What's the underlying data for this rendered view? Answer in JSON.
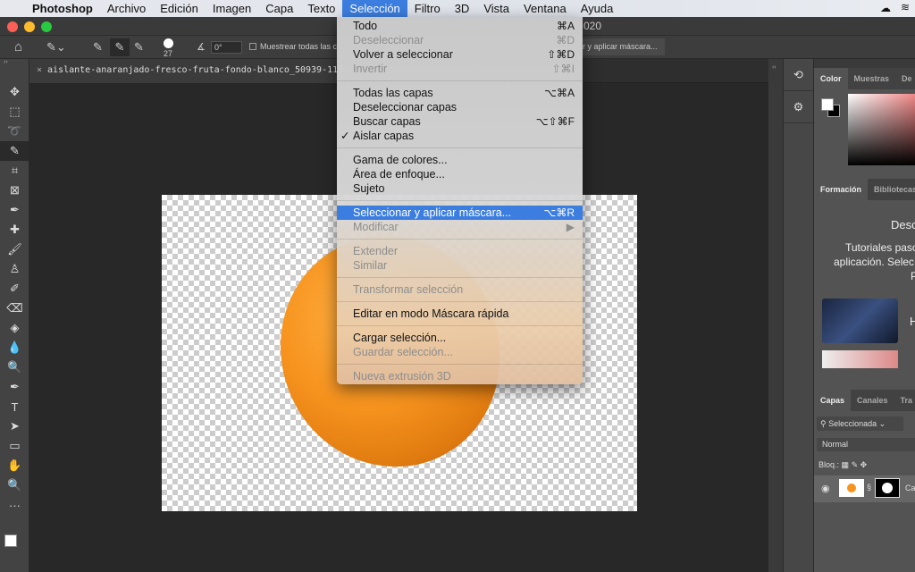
{
  "menubar": {
    "apple": "",
    "app": "Photoshop",
    "items": [
      "Archivo",
      "Edición",
      "Imagen",
      "Capa",
      "Texto",
      "Selección",
      "Filtro",
      "3D",
      "Vista",
      "Ventana",
      "Ayuda"
    ]
  },
  "titlebar": {
    "title_fragment": "020"
  },
  "options": {
    "brush_size": "27",
    "angle": "0°",
    "sample_all_label": "Muestrear todas las c",
    "select_mask_button": "r y aplicar máscara..."
  },
  "document": {
    "tab": "aislante-anaranjado-fresco-fruta-fondo-blanco_50939-115.jpg a"
  },
  "menu": {
    "items": [
      {
        "label": "Todo",
        "key": "⌘A",
        "disabled": false
      },
      {
        "label": "Deseleccionar",
        "key": "⌘D",
        "disabled": true
      },
      {
        "label": "Volver a seleccionar",
        "key": "⇧⌘D",
        "disabled": false
      },
      {
        "label": "Invertir",
        "key": "⇧⌘I",
        "disabled": true
      },
      {
        "sep": true
      },
      {
        "label": "Todas las capas",
        "key": "⌥⌘A",
        "disabled": false
      },
      {
        "label": "Deseleccionar capas",
        "key": "",
        "disabled": false
      },
      {
        "label": "Buscar capas",
        "key": "⌥⇧⌘F",
        "disabled": false
      },
      {
        "label": "Aislar capas",
        "key": "",
        "disabled": false,
        "checked": true
      },
      {
        "sep": true
      },
      {
        "label": "Gama de colores...",
        "key": "",
        "disabled": false
      },
      {
        "label": "Área de enfoque...",
        "key": "",
        "disabled": false
      },
      {
        "label": "Sujeto",
        "key": "",
        "disabled": false
      },
      {
        "sep": true
      },
      {
        "label": "Seleccionar y aplicar máscara...",
        "key": "⌥⌘R",
        "disabled": false,
        "highlighted": true
      },
      {
        "label": "Modificar",
        "key": "▶",
        "disabled": true
      },
      {
        "sep": true
      },
      {
        "label": "Extender",
        "key": "",
        "disabled": true
      },
      {
        "label": "Similar",
        "key": "",
        "disabled": true
      },
      {
        "sep": true
      },
      {
        "label": "Transformar selección",
        "key": "",
        "disabled": true
      },
      {
        "sep": true
      },
      {
        "label": "Editar en modo Máscara rápida",
        "key": "",
        "disabled": false
      },
      {
        "sep": true
      },
      {
        "label": "Cargar selección...",
        "key": "",
        "disabled": false
      },
      {
        "label": "Guardar selección...",
        "key": "",
        "disabled": true
      },
      {
        "sep": true
      },
      {
        "label": "Nueva extrusión 3D",
        "key": "",
        "disabled": true
      }
    ]
  },
  "tools": [
    "move-icon",
    "marquee-icon",
    "lasso-icon",
    "quick-selection-icon",
    "crop-icon",
    "frame-icon",
    "eyedropper-icon",
    "healing-icon",
    "brush-icon",
    "stamp-icon",
    "history-brush-icon",
    "eraser-icon",
    "paint-bucket-icon",
    "blur-icon",
    "dodge-icon",
    "pen-icon",
    "type-icon",
    "path-selection-icon",
    "rectangle-icon",
    "hand-icon",
    "zoom-icon",
    "more-icon"
  ],
  "tool_glyphs": [
    "✥",
    "⬚",
    "➰",
    "✎",
    "⌗",
    "⊠",
    "✒",
    "✚",
    "🖌",
    "♙",
    "✐",
    "⌫",
    "◈",
    "💧",
    "🔍",
    "✒",
    "T",
    "➤",
    "▭",
    "✋",
    "🔍",
    "···"
  ],
  "color_panel": {
    "tabs": [
      "Color",
      "Muestras",
      "De"
    ]
  },
  "learn_panel": {
    "tabs": [
      "Formación",
      "Bibliotecas"
    ],
    "heading": "Desc",
    "text1": "Tutoriales paso",
    "text2": "aplicación. Selec",
    "text3": "P",
    "card_letter": "H"
  },
  "layers_panel": {
    "tabs": [
      "Capas",
      "Canales",
      "Tra"
    ],
    "filter": "Seleccionada",
    "blend": "Normal",
    "lock_label": "Bloq.:",
    "layer_name": "Ca"
  },
  "colors": {
    "accent": "#3b7ee0",
    "panel": "#535353"
  }
}
